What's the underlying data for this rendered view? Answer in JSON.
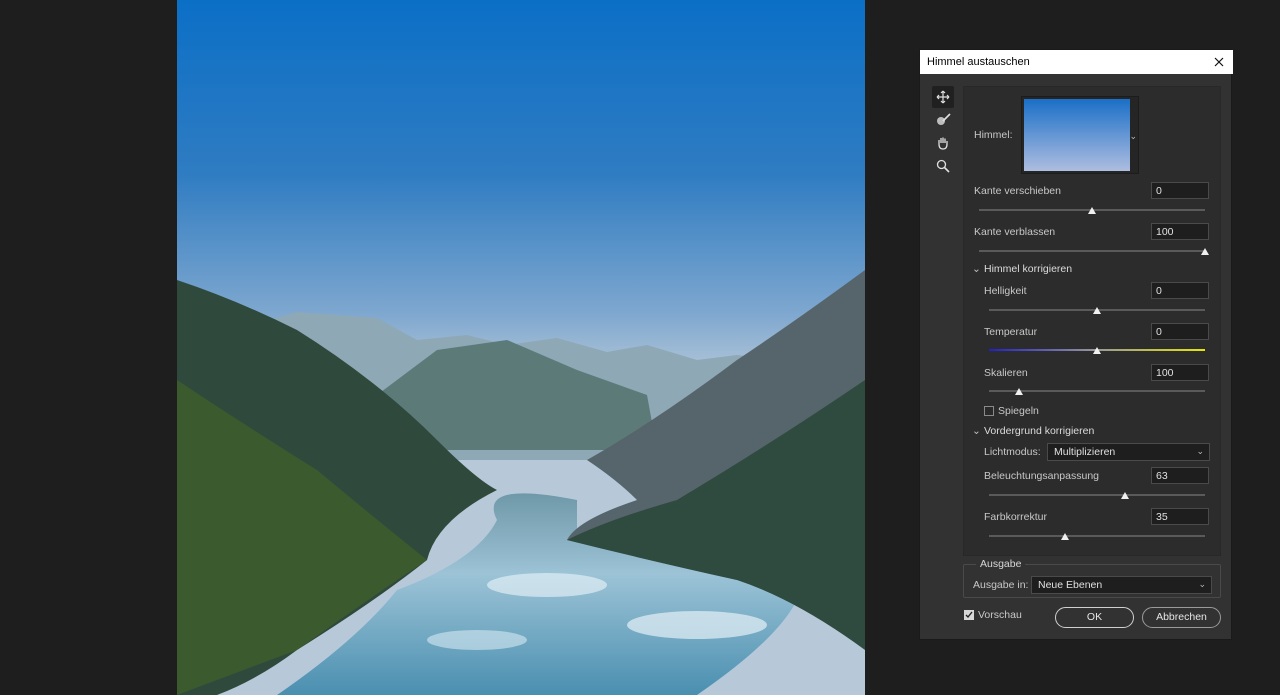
{
  "dialog": {
    "title": "Himmel austauschen",
    "sky_label": "Himmel:",
    "edge": {
      "shift_label": "Kante verschieben",
      "shift_value": "0",
      "shift_level": 0.5,
      "fade_label": "Kante verblassen",
      "fade_value": "100",
      "fade_level": 1.0
    },
    "sky_adjust": {
      "heading": "Himmel korrigieren",
      "brightness_label": "Helligkeit",
      "brightness_value": "0",
      "brightness_level": 0.5,
      "temperature_label": "Temperatur",
      "temperature_value": "0",
      "temperature_level": 0.5,
      "scale_label": "Skalieren",
      "scale_value": "100",
      "scale_level": 0.14,
      "flip_label": "Spiegeln",
      "flip_checked": false
    },
    "foreground": {
      "heading": "Vordergrund korrigieren",
      "light_mode_label": "Lichtmodus:",
      "light_mode_value": "Multiplizieren",
      "lighting_label": "Beleuchtungsanpassung",
      "lighting_value": "63",
      "lighting_level": 0.63,
      "color_label": "Farbkorrektur",
      "color_value": "35",
      "color_level": 0.35
    },
    "output": {
      "heading": "Ausgabe",
      "output_to_label": "Ausgabe in:",
      "output_to_value": "Neue Ebenen"
    },
    "preview_label": "Vorschau",
    "preview_checked": true,
    "ok_label": "OK",
    "cancel_label": "Abbrechen"
  },
  "colors": {
    "accent": "#1a6fc7",
    "temperature_cold": "#2020c8",
    "temperature_warm": "#e6e600"
  },
  "icons": [
    "move-icon",
    "sky-brush-icon",
    "hand-icon",
    "zoom-icon",
    "close-icon",
    "chevron-down-icon"
  ]
}
